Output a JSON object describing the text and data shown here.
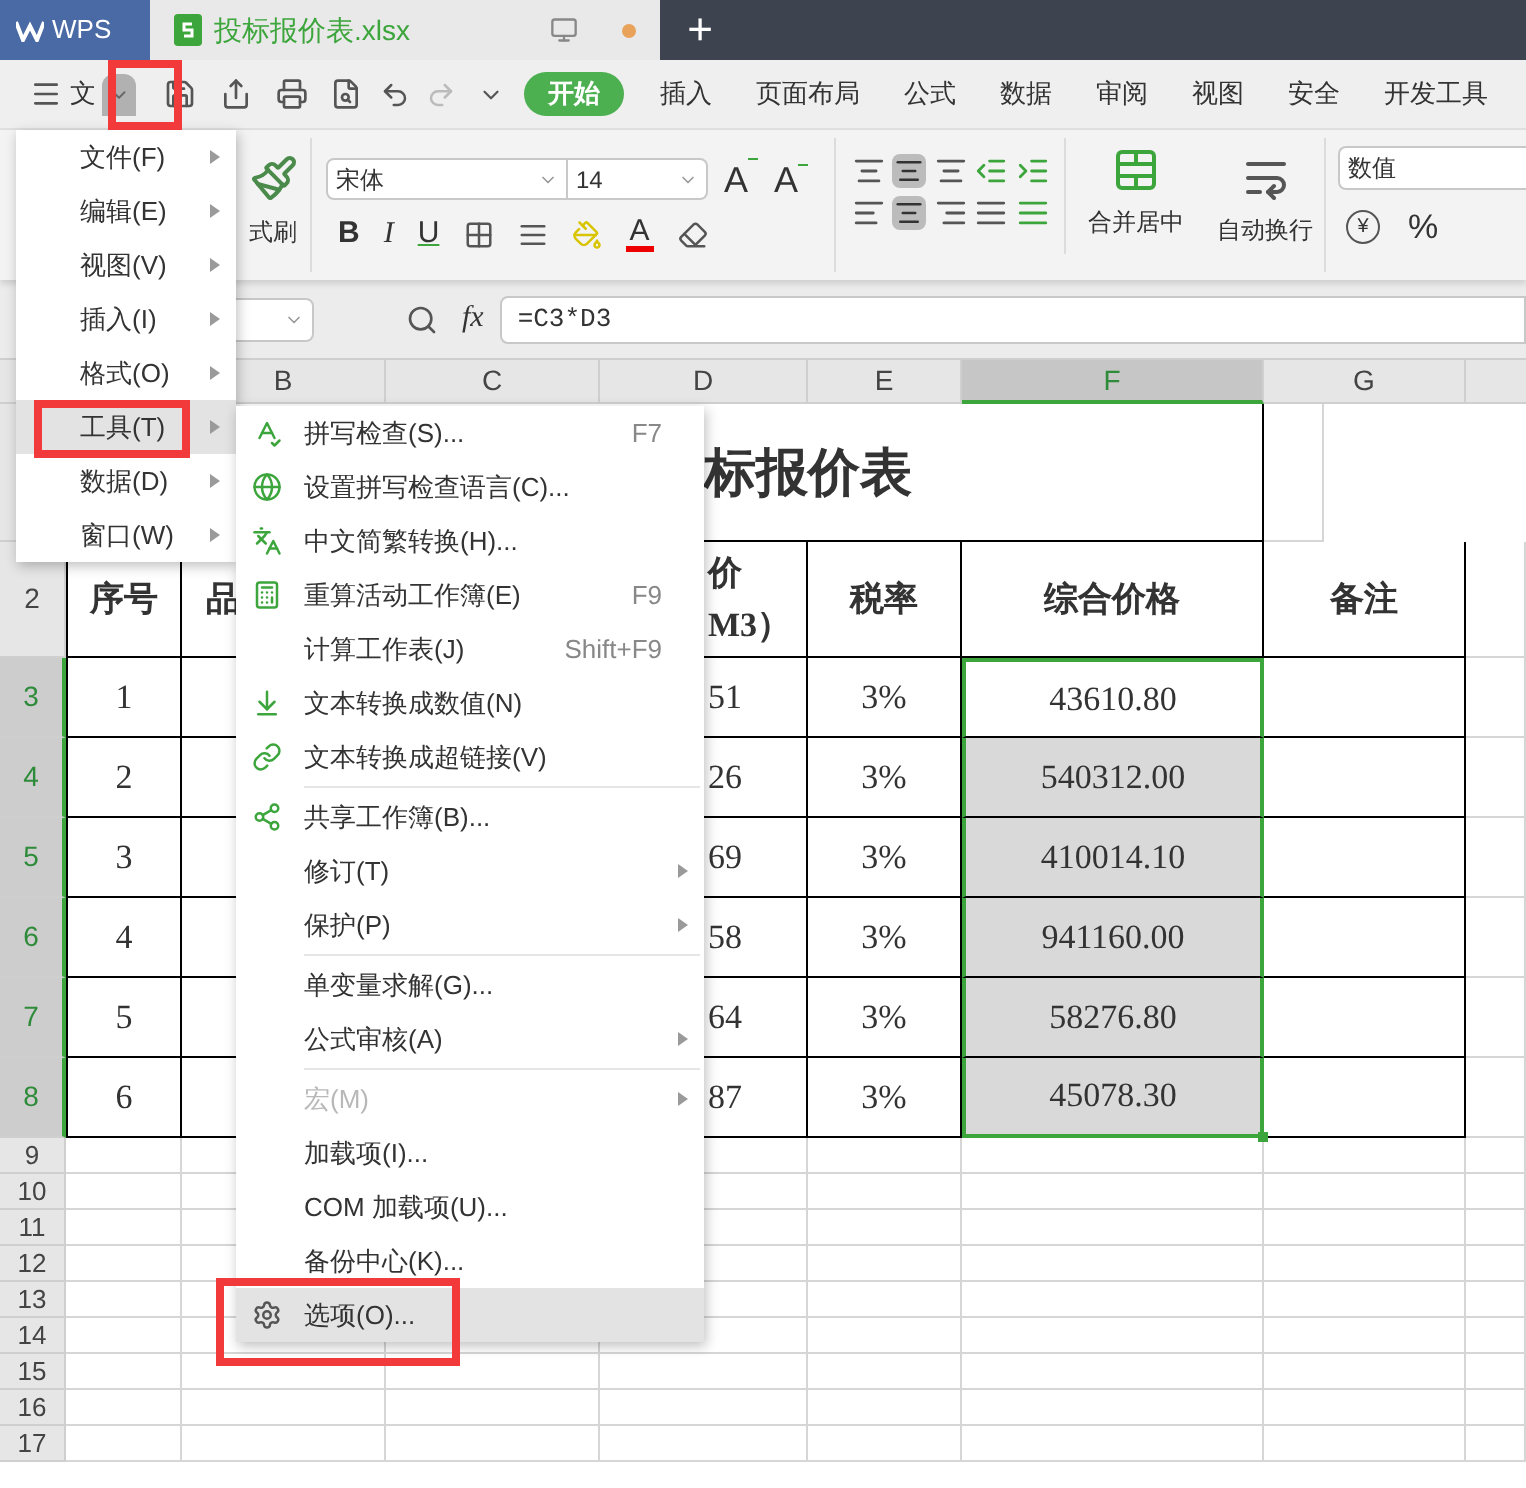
{
  "title_bar": {
    "app_tab": "WPS",
    "document_tab": "投标报价表.xlsx",
    "new_tab": "+"
  },
  "toolbar": {
    "menu_label": "文",
    "tabs": [
      {
        "label": "开始",
        "selected": true
      },
      {
        "label": "插入",
        "selected": false
      },
      {
        "label": "页面布局",
        "selected": false
      },
      {
        "label": "公式",
        "selected": false
      },
      {
        "label": "数据",
        "selected": false
      },
      {
        "label": "审阅",
        "selected": false
      },
      {
        "label": "视图",
        "selected": false
      },
      {
        "label": "安全",
        "selected": false
      },
      {
        "label": "开发工具",
        "selected": false
      }
    ]
  },
  "ribbon": {
    "format_painter": "式刷",
    "font": "宋体",
    "font_size": "14",
    "font_buttons": [
      "A",
      "A"
    ],
    "style_buttons": [
      "B",
      "I",
      "U"
    ],
    "font_color_letter": "A",
    "merge": "合并居中",
    "wrap": "自动换行",
    "number_format": "数值",
    "currency": "¥",
    "percent": "%"
  },
  "formula_bar": {
    "fx": "fx",
    "formula": "=C3*D3"
  },
  "sheet": {
    "columns": [
      {
        "label": "B",
        "selected": false
      },
      {
        "label": "C",
        "selected": false
      },
      {
        "label": "D",
        "selected": false
      },
      {
        "label": "E",
        "selected": false
      },
      {
        "label": "F",
        "selected": true
      },
      {
        "label": "G",
        "selected": false
      }
    ],
    "title": "标报价表",
    "header_row": {
      "row": "2",
      "no": "序号",
      "b": "品",
      "d": [
        "价",
        "M3）"
      ],
      "e": "税率",
      "f": "综合价格",
      "g": "备注"
    },
    "rows": [
      {
        "row": "3",
        "selected": true,
        "no": "1",
        "d": "51",
        "e": "3%",
        "f": "43610.80",
        "active": true
      },
      {
        "row": "4",
        "selected": true,
        "no": "2",
        "d": "26",
        "e": "3%",
        "f": "540312.00",
        "active": false
      },
      {
        "row": "5",
        "selected": true,
        "no": "3",
        "d": "69",
        "e": "3%",
        "f": "410014.10",
        "active": false
      },
      {
        "row": "6",
        "selected": true,
        "no": "4",
        "d": "58",
        "e": "3%",
        "f": "941160.00",
        "active": false
      },
      {
        "row": "7",
        "selected": true,
        "no": "5",
        "d": "64",
        "e": "3%",
        "f": "58276.80",
        "active": false
      },
      {
        "row": "8",
        "selected": true,
        "no": "6",
        "d": "87",
        "e": "3%",
        "f": "45078.30",
        "active": false
      }
    ],
    "empty_rows": [
      "9",
      "10",
      "11",
      "12",
      "13",
      "14",
      "15",
      "16",
      "17"
    ]
  },
  "menu": {
    "items": [
      {
        "label": "文件(F)",
        "selected": false,
        "has_submenu": true
      },
      {
        "label": "编辑(E)",
        "selected": false,
        "has_submenu": true
      },
      {
        "label": "视图(V)",
        "selected": false,
        "has_submenu": true
      },
      {
        "label": "插入(I)",
        "selected": false,
        "has_submenu": true
      },
      {
        "label": "格式(O)",
        "selected": false,
        "has_submenu": true
      },
      {
        "label": "工具(T)",
        "selected": true,
        "has_submenu": true
      },
      {
        "label": "数据(D)",
        "selected": false,
        "has_submenu": true
      },
      {
        "label": "窗口(W)",
        "selected": false,
        "has_submenu": true
      }
    ]
  },
  "submenu": {
    "items": [
      {
        "kind": "item",
        "label": "拼写检查(S)...",
        "shortcut": "F7",
        "has_submenu": false,
        "disabled": false,
        "selected": false
      },
      {
        "kind": "item",
        "label": "设置拼写检查语言(C)...",
        "has_submenu": false,
        "disabled": false,
        "selected": false
      },
      {
        "kind": "item",
        "label": "中文简繁转换(H)...",
        "has_submenu": false,
        "disabled": false,
        "selected": false
      },
      {
        "kind": "item",
        "label": "重算活动工作簿(E)",
        "shortcut": "F9",
        "has_submenu": false,
        "disabled": false,
        "selected": false
      },
      {
        "kind": "item",
        "label": "计算工作表(J)",
        "shortcut": "Shift+F9",
        "has_submenu": false,
        "disabled": false,
        "selected": false
      },
      {
        "kind": "item",
        "label": "文本转换成数值(N)",
        "has_submenu": false,
        "disabled": false,
        "selected": false
      },
      {
        "kind": "item",
        "label": "文本转换成超链接(V)",
        "has_submenu": false,
        "disabled": false,
        "selected": false
      },
      {
        "kind": "separator"
      },
      {
        "kind": "item",
        "label": "共享工作簿(B)...",
        "has_submenu": false,
        "disabled": false,
        "selected": false
      },
      {
        "kind": "item",
        "label": "修订(T)",
        "has_submenu": true,
        "disabled": false,
        "selected": false
      },
      {
        "kind": "item",
        "label": "保护(P)",
        "has_submenu": true,
        "disabled": false,
        "selected": false
      },
      {
        "kind": "separator"
      },
      {
        "kind": "item",
        "label": "单变量求解(G)...",
        "has_submenu": false,
        "disabled": false,
        "selected": false
      },
      {
        "kind": "item",
        "label": "公式审核(A)",
        "has_submenu": true,
        "disabled": false,
        "selected": false
      },
      {
        "kind": "separator"
      },
      {
        "kind": "item",
        "label": "宏(M)",
        "has_submenu": true,
        "disabled": true,
        "selected": false
      },
      {
        "kind": "item",
        "label": "加载项(I)...",
        "has_submenu": false,
        "disabled": false,
        "selected": false
      },
      {
        "kind": "item",
        "label": "COM 加载项(U)...",
        "has_submenu": false,
        "disabled": false,
        "selected": false
      },
      {
        "kind": "item",
        "label": "备份中心(K)...",
        "has_submenu": false,
        "disabled": false,
        "selected": false
      },
      {
        "kind": "item",
        "label": "选项(O)...",
        "has_submenu": false,
        "disabled": false,
        "selected": true
      }
    ]
  }
}
